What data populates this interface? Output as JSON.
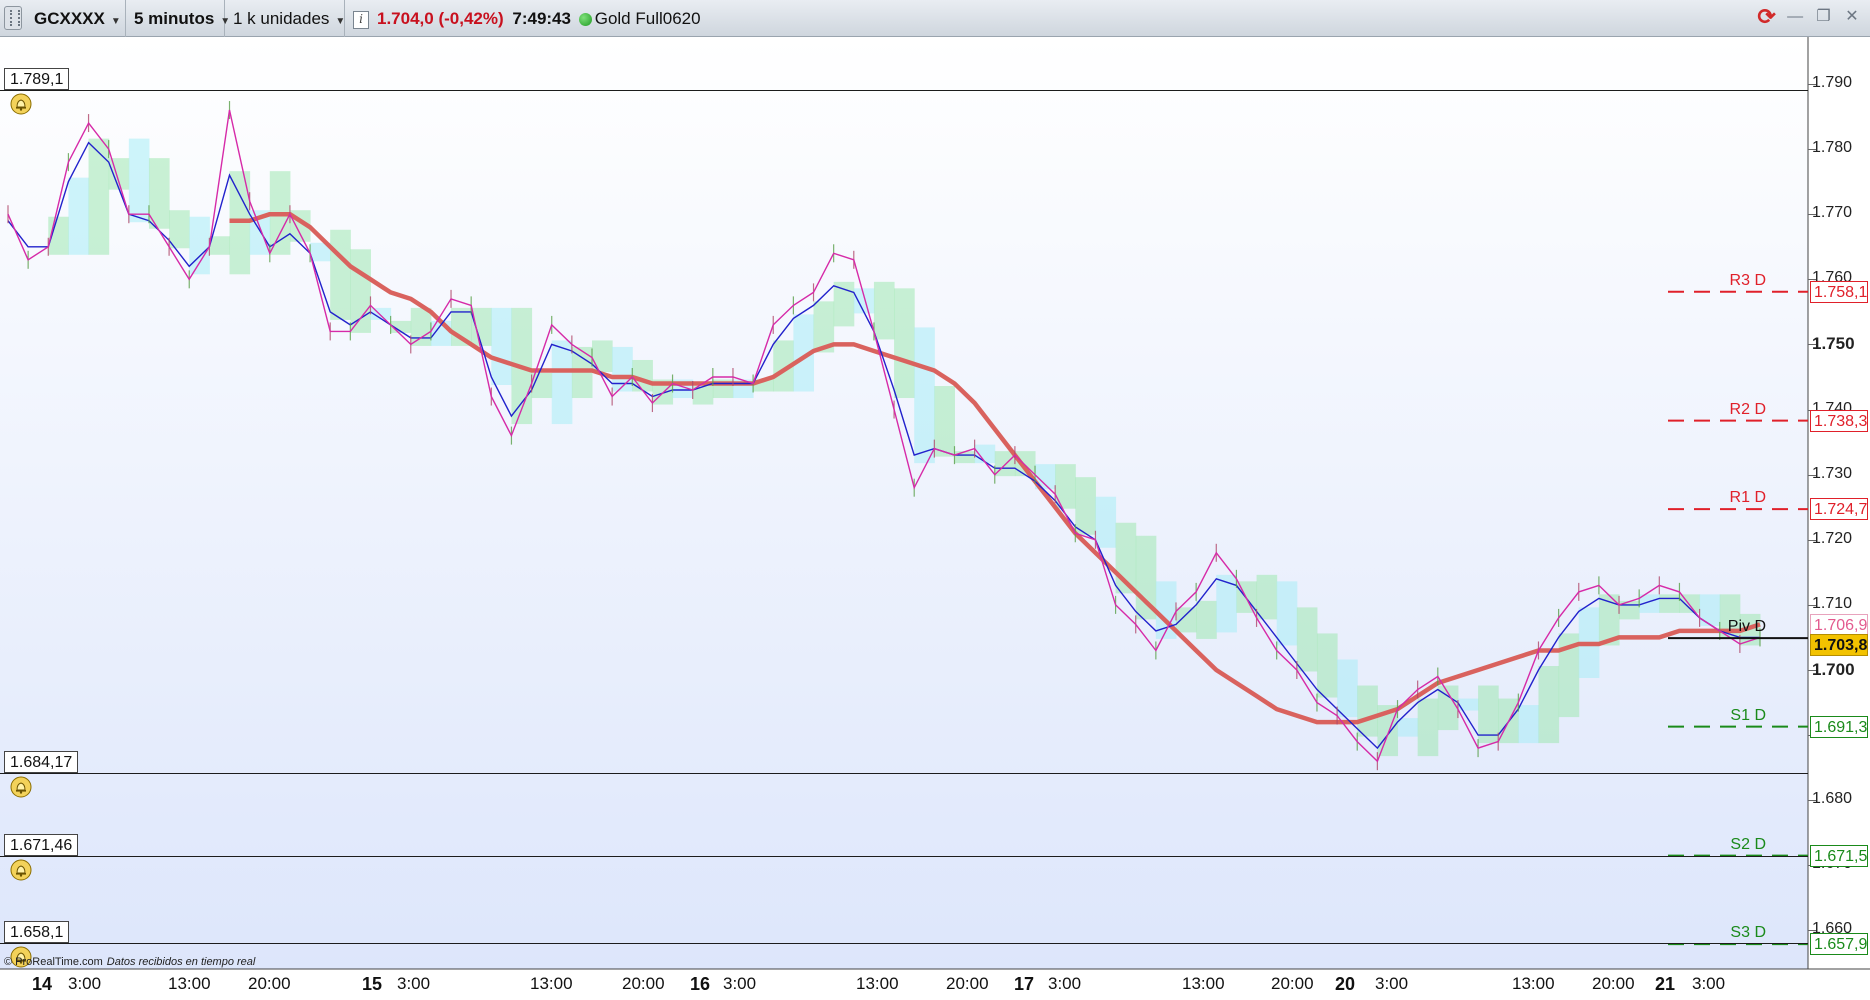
{
  "toolbar": {
    "symbol": "GCXXXX",
    "timeframe": "5 minutos",
    "units": "1 k unidades",
    "price": "1.704,0 (-0,42%)",
    "time": "7:49:43",
    "instrument": "Gold Full0620"
  },
  "price_axis": {
    "labels": [
      "1.790",
      "1.780",
      "1.770",
      "1.760",
      "1.750",
      "1.740",
      "1.730",
      "1.720",
      "1.710",
      "1.700",
      "1.690",
      "1.680",
      "1.670",
      "1.660"
    ],
    "bold_labels": [
      "1.750",
      "1.700"
    ]
  },
  "horizontal_levels": [
    {
      "value": "1.789,1",
      "price": 1789.1
    },
    {
      "value": "1.684,17",
      "price": 1684.17
    },
    {
      "value": "1.671,46",
      "price": 1671.46
    },
    {
      "value": "1.658,1",
      "price": 1658.1
    }
  ],
  "pivots": [
    {
      "name": "R3 D",
      "value": "1.758,1",
      "price": 1758.1,
      "color": "#e0202a"
    },
    {
      "name": "R2 D",
      "value": "1.738,3",
      "price": 1738.3,
      "color": "#e0202a"
    },
    {
      "name": "R1 D",
      "value": "1.724,7",
      "price": 1724.7,
      "color": "#e0202a"
    },
    {
      "name": "Piv D",
      "value": "1.704,9",
      "price": 1704.9,
      "color": "#111111"
    },
    {
      "name": "S1 D",
      "value": "1.691,3",
      "price": 1691.3,
      "color": "#1a8a1a"
    },
    {
      "name": "S2 D",
      "value": "1.671,5",
      "price": 1671.5,
      "color": "#1a8a1a"
    },
    {
      "name": "S3 D",
      "value": "1.657,9",
      "price": 1657.9,
      "color": "#1a8a1a"
    }
  ],
  "price_tags": {
    "ma_value": "1.706,9",
    "current": "1.703,8",
    "current_price": 1703.8,
    "current_bg": "#f2c200"
  },
  "time_axis": [
    {
      "label": "14",
      "day": true
    },
    {
      "label": "3:00",
      "day": false
    },
    {
      "label": "13:00",
      "day": false
    },
    {
      "label": "20:00",
      "day": false
    },
    {
      "label": "15",
      "day": true
    },
    {
      "label": "3:00",
      "day": false
    },
    {
      "label": "13:00",
      "day": false
    },
    {
      "label": "20:00",
      "day": false
    },
    {
      "label": "16",
      "day": true
    },
    {
      "label": "3:00",
      "day": false
    },
    {
      "label": "13:00",
      "day": false
    },
    {
      "label": "20:00",
      "day": false
    },
    {
      "label": "17",
      "day": true
    },
    {
      "label": "3:00",
      "day": false
    },
    {
      "label": "13:00",
      "day": false
    },
    {
      "label": "20:00",
      "day": false
    },
    {
      "label": "20",
      "day": true
    },
    {
      "label": "3:00",
      "day": false
    },
    {
      "label": "13:00",
      "day": false
    },
    {
      "label": "20:00",
      "day": false
    },
    {
      "label": "21",
      "day": true
    },
    {
      "label": "3:00",
      "day": false
    }
  ],
  "footer": {
    "brand": "© ProRealTime.com",
    "status": "Datos recibidos en tiempo real"
  },
  "colors": {
    "price_line": "#d62aa8",
    "fast_line": "#2222cc",
    "ma_line": "#d9625e",
    "cloud_green": "#9fe8b0",
    "cloud_cyan": "#a8ecf5",
    "background_top": "#ffffff",
    "background_bottom": "#dde6fb"
  },
  "icons": {
    "alert": "bell-icon",
    "refresh": "refresh-icon",
    "minimize": "minimize-icon",
    "restore": "restore-icon",
    "close": "close-icon"
  },
  "chart_data": {
    "type": "line",
    "ylim": [
      1654,
      1795
    ],
    "series": [
      {
        "values": [
          1770,
          1763,
          1765,
          1778,
          1784,
          1780,
          1770,
          1770,
          1765,
          1760,
          1765,
          1786,
          1772,
          1764,
          1770,
          1764,
          1752,
          1752,
          1756,
          1753,
          1750,
          1752,
          1757,
          1756,
          1742,
          1736,
          1744,
          1753,
          1750,
          1748,
          1742,
          1745,
          1741,
          1744,
          1743,
          1745,
          1745,
          1744,
          1753,
          1756,
          1758,
          1764,
          1763,
          1752,
          1740,
          1728,
          1734,
          1733,
          1734,
          1730,
          1733,
          1730,
          1727,
          1721,
          1720,
          1710,
          1707,
          1703,
          1709,
          1712,
          1718,
          1714,
          1708,
          1703,
          1700,
          1695,
          1693,
          1689,
          1686,
          1694,
          1697,
          1699,
          1694,
          1688,
          1689,
          1695,
          1703,
          1708,
          1712,
          1713,
          1710,
          1711,
          1713,
          1712,
          1708,
          1706,
          1704,
          1705
        ]
      },
      {
        "values": [
          1769,
          1765,
          1765,
          1775,
          1781,
          1778,
          1770,
          1769,
          1766,
          1762,
          1765,
          1776,
          1770,
          1765,
          1767,
          1764,
          1755,
          1753,
          1755,
          1753,
          1751,
          1751,
          1755,
          1755,
          1745,
          1739,
          1743,
          1750,
          1749,
          1747,
          1744,
          1744,
          1742,
          1743,
          1743,
          1744,
          1744,
          1744,
          1750,
          1754,
          1756,
          1759,
          1758,
          1752,
          1743,
          1733,
          1734,
          1733,
          1733,
          1731,
          1731,
          1729,
          1726,
          1722,
          1720,
          1713,
          1709,
          1706,
          1707,
          1710,
          1714,
          1713,
          1709,
          1705,
          1701,
          1697,
          1694,
          1691,
          1688,
          1692,
          1695,
          1697,
          1695,
          1690,
          1690,
          1694,
          1700,
          1705,
          1709,
          1711,
          1710,
          1710,
          1711,
          1711,
          1708,
          1706,
          1705,
          1705
        ]
      },
      {
        "values": [
          null,
          null,
          null,
          null,
          null,
          null,
          null,
          null,
          null,
          null,
          null,
          1769,
          1769,
          1770,
          1770,
          1768,
          1765,
          1762,
          1760,
          1758,
          1757,
          1755,
          1752,
          1750,
          1748,
          1747,
          1746,
          1746,
          1746,
          1746,
          1745,
          1745,
          1744,
          1744,
          1744,
          1744,
          1744,
          1744,
          1745,
          1747,
          1749,
          1750,
          1750,
          1749,
          1748,
          1747,
          1746,
          1744,
          1741,
          1737,
          1733,
          1729,
          1725,
          1721,
          1718,
          1715,
          1712,
          1709,
          1706,
          1703,
          1700,
          1698,
          1696,
          1694,
          1693,
          1692,
          1692,
          1692,
          1693,
          1694,
          1696,
          1698,
          1699,
          1700,
          1701,
          1702,
          1703,
          1703,
          1704,
          1704,
          1705,
          1705,
          1705,
          1706,
          1706,
          1706,
          1706,
          1707
        ]
      }
    ]
  }
}
